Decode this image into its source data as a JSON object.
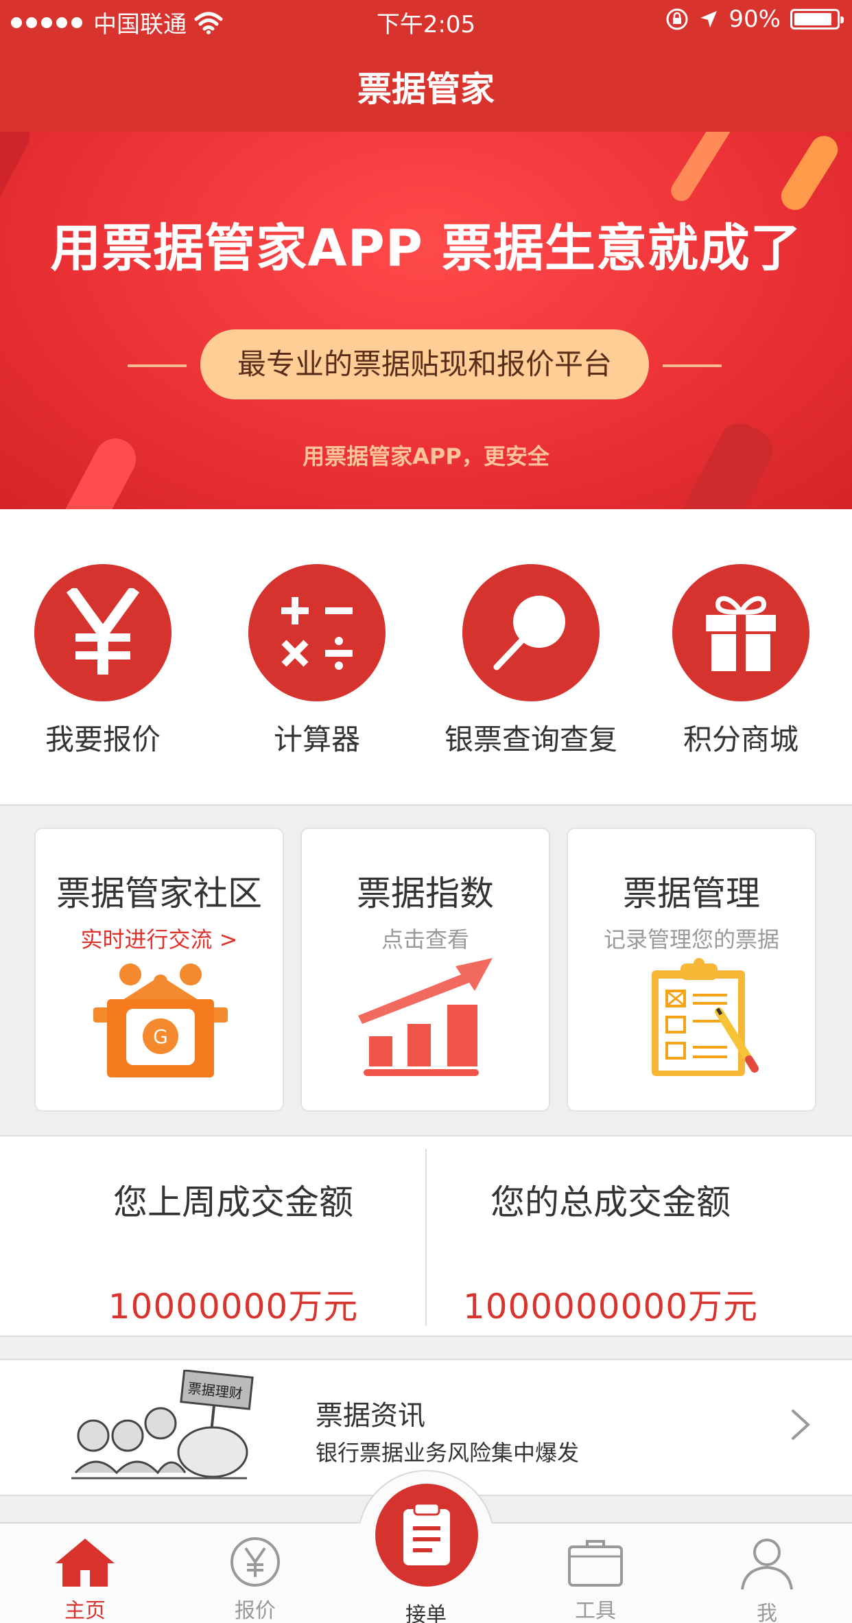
{
  "status_bar": {
    "carrier": "中国联通",
    "time": "下午2:05",
    "battery": "90%",
    "battery_level": 0.9
  },
  "nav": {
    "title": "票据管家"
  },
  "banner": {
    "headline": "用票据管家APP  票据生意就成了",
    "pill": "最专业的票据贴现和报价平台",
    "subline": "用票据管家APP，更安全"
  },
  "quick_actions": [
    {
      "label": "我要报价",
      "icon": "yen-icon"
    },
    {
      "label": "计算器",
      "icon": "calculator-icon"
    },
    {
      "label": "银票查询查复",
      "icon": "search-icon"
    },
    {
      "label": "积分商城",
      "icon": "gift-icon"
    }
  ],
  "cards": [
    {
      "title": "票据管家社区",
      "subtitle": "实时进行交流 >",
      "icon": "community-house-icon"
    },
    {
      "title": "票据指数",
      "subtitle": "点击查看",
      "icon": "trend-chart-icon"
    },
    {
      "title": "票据管理",
      "subtitle": "记录管理您的票据",
      "icon": "clipboard-icon"
    }
  ],
  "amounts": {
    "last_week_label": "您上周成交金额",
    "last_week_value": "10000000万元",
    "total_label": "您的总成交金额",
    "total_value": "1000000000万元"
  },
  "news": {
    "title": "票据资讯",
    "summary": "银行票据业务风险集中爆发",
    "thumb_sign": "票据理财"
  },
  "tabbar": {
    "home": "主页",
    "quote": "报价",
    "center": "接单",
    "tools": "工具",
    "me": "我"
  },
  "colors": {
    "brand_red": "#d9332e",
    "banner_pill": "#ffcd96",
    "card_orange": "#f5892d"
  }
}
